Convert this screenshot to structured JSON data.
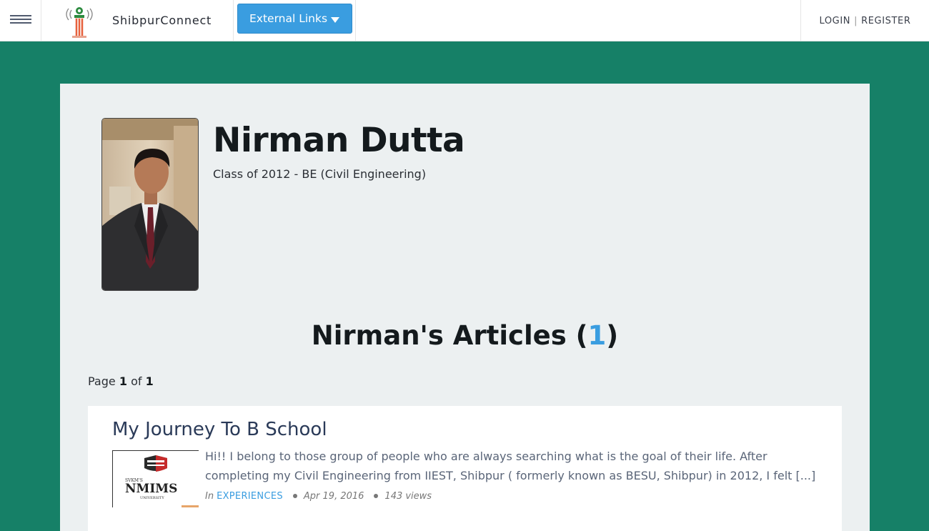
{
  "header": {
    "site_name": "ShibpurConnect",
    "external_links_label": "External Links",
    "login_label": "LOGIN",
    "register_label": "REGISTER",
    "separator": "|"
  },
  "profile": {
    "name": "Nirman Dutta",
    "class_line": "Class of 2012 - BE (Civil Engineering)"
  },
  "articles": {
    "heading_prefix": "Nirman's Articles (",
    "count": "1",
    "heading_suffix": ")",
    "page_label": "Page",
    "page_current": "1",
    "page_of": "of",
    "page_total": "1",
    "items": [
      {
        "title": "My Journey To B School",
        "excerpt": "Hi!! I belong to those group of people who are always searching what is the goal of their life. After completing my Civil Engineering from IIEST, Shibpur ( formerly known as BESU, Shibpur) in 2012, I felt [...]",
        "in_label": "In",
        "category": "EXPERIENCES",
        "date": "Apr 19, 2016",
        "views": "143 views",
        "thumb_text": "NMIMS",
        "thumb_small_top": "SVKM'S",
        "thumb_small_bottom": "UNIVERSITY"
      }
    ]
  },
  "colors": {
    "page_background": "#168067",
    "panel_background": "#ecf0f1",
    "accent": "#3a9de0",
    "heading_text": "#141a1d"
  }
}
